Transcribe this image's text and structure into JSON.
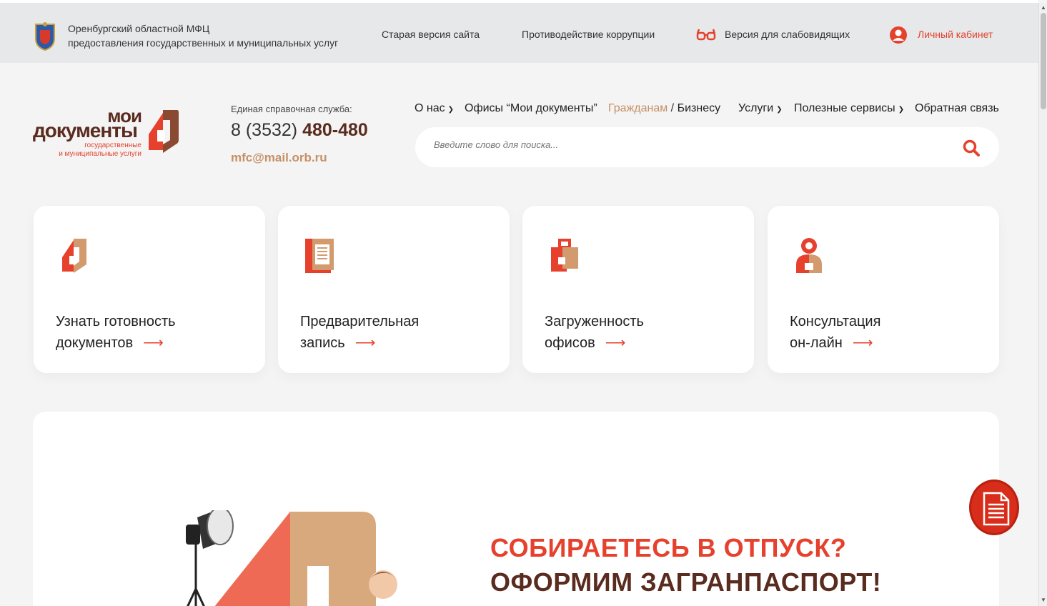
{
  "topbar": {
    "org_line1": "Оренбургский областной МФЦ",
    "org_line2": "предоставления государственных и муниципальных услуг",
    "old_site": "Старая версия сайта",
    "anticorruption": "Противодействие коррупции",
    "low_vision": "Версия для слабовидящих",
    "cabinet": "Личный кабинет"
  },
  "logo": {
    "line1": "мои",
    "line2": "документы",
    "line3": "государственные",
    "line4": "и муниципальные услуги"
  },
  "contacts": {
    "hotline_label": "Единая справочная служба:",
    "phone_prefix": "8 (3532) ",
    "phone_main": "480-480",
    "email": "mfc@mail.orb.ru"
  },
  "nav": {
    "about": "О нас",
    "offices": "Офисы “Мои документы”",
    "citizens": "Гражданам",
    "separator": " / ",
    "business": "Бизнесу",
    "services": "Услуги",
    "useful": "Полезные сервисы",
    "feedback": "Обратная связь"
  },
  "search": {
    "placeholder": "Введите слово для поиска..."
  },
  "cards": [
    {
      "line1": "Узнать готовность",
      "line2": "документов",
      "icon": "document-status-icon"
    },
    {
      "line1": "Предварительная",
      "line2": "запись",
      "icon": "appointment-icon"
    },
    {
      "line1": "Загруженность",
      "line2": "офисов",
      "icon": "office-load-icon"
    },
    {
      "line1": "Консультация",
      "line2": "он-лайн",
      "icon": "consultation-icon"
    }
  ],
  "banner": {
    "headline1": "СОБИРАЕТЕСЬ В ОТПУСК?",
    "headline2": "ОФОРМИМ ЗАГРАНПАСПОРТ!"
  },
  "colors": {
    "accent_red": "#e6412d",
    "brown": "#5a2b1f",
    "tan": "#c69066"
  }
}
